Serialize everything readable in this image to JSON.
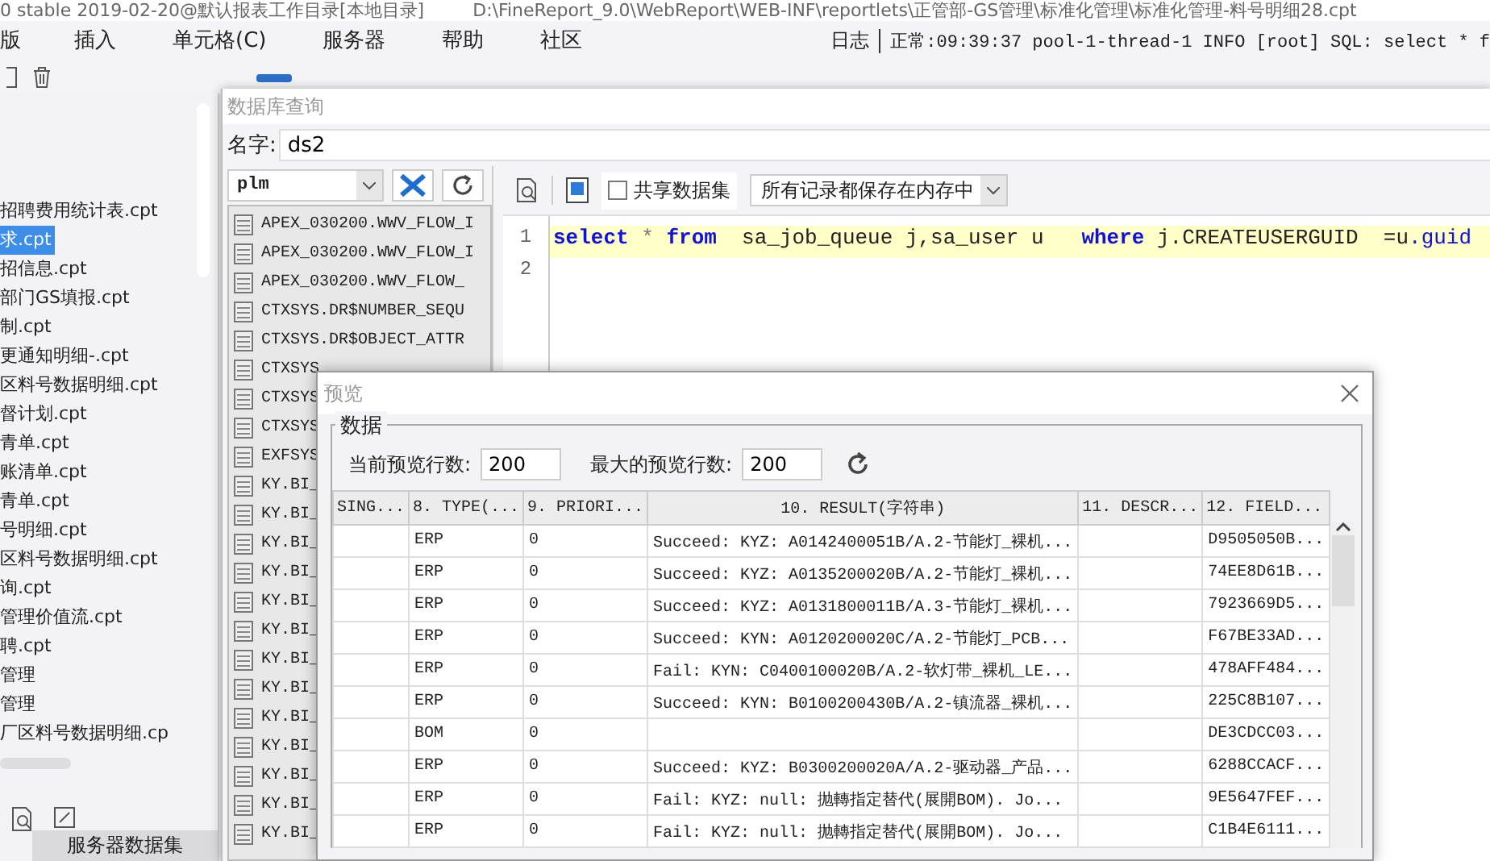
{
  "title_bar": {
    "workspace": "0 stable 2019-02-20@默认报表工作目录[本地目录]",
    "path": "D:\\FineReport_9.0\\WebReport\\WEB-INF\\reportlets\\正管部-GS管理\\标准化管理\\标准化管理-料号明细28.cpt"
  },
  "menu": [
    "版",
    "插入",
    "单元格(C)",
    "服务器",
    "帮助",
    "社区"
  ],
  "log": {
    "label": "日志",
    "message": "正常:09:39:37 pool-1-thread-1 INFO [root] SQL: select * f"
  },
  "file_tree": {
    "items": [
      {
        "label": "招聘费用统计表.cpt",
        "selected": false
      },
      {
        "label": "求.cpt",
        "selected": true
      },
      {
        "label": "招信息.cpt",
        "selected": false
      },
      {
        "label": "部门GS填报.cpt",
        "selected": false
      },
      {
        "label": "制.cpt",
        "selected": false
      },
      {
        "label": "更通知明细-.cpt",
        "selected": false
      },
      {
        "label": "区料号数据明细.cpt",
        "selected": false
      },
      {
        "label": "督计划.cpt",
        "selected": false
      },
      {
        "label": "青单.cpt",
        "selected": false
      },
      {
        "label": "账清单.cpt",
        "selected": false
      },
      {
        "label": "青单.cpt",
        "selected": false
      },
      {
        "label": "号明细.cpt",
        "selected": false
      },
      {
        "label": "区料号数据明细.cpt",
        "selected": false
      },
      {
        "label": "询.cpt",
        "selected": false
      },
      {
        "label": "管理价值流.cpt",
        "selected": false
      },
      {
        "label": "聘.cpt",
        "selected": false
      },
      {
        "label": "管理",
        "selected": false
      },
      {
        "label": "管理",
        "selected": false
      },
      {
        "label": "厂区料号数据明细.cp",
        "selected": false
      }
    ]
  },
  "dataset_tab": {
    "label": "服务器数据集"
  },
  "db_query": {
    "title": "数据库查询",
    "name_label": "名字:",
    "name_value": "ds2",
    "connection": "plm",
    "tables": [
      "APEX_030200.WWV_FLOW_I",
      "APEX_030200.WWV_FLOW_I",
      "APEX_030200.WWV_FLOW_",
      "CTXSYS.DR$NUMBER_SEQU",
      "CTXSYS.DR$OBJECT_ATTR",
      "CTXSYS",
      "CTXSYS",
      "CTXSYS",
      "EXFSYS",
      "KY.BI_",
      "KY.BI_",
      "KY.BI_",
      "KY.BI_",
      "KY.BI_",
      "KY.BI_",
      "KY.BI_",
      "KY.BI_",
      "KY.BI_",
      "KY.BI_",
      "KY.BI_",
      "KY.BI_",
      "KY.BI_"
    ],
    "share_label": "共享数据集",
    "share_checked": false,
    "storage_mode": "所有记录都保存在内存中",
    "sql_lines": [
      {
        "number": "1",
        "highlighted": true,
        "tokens": [
          {
            "text": "select",
            "kind": "keyword"
          },
          {
            "text": " * ",
            "kind": "operator"
          },
          {
            "text": "from",
            "kind": "keyword"
          },
          {
            "text": "  sa_job_queue j,sa_user u   ",
            "kind": "plain"
          },
          {
            "text": "where",
            "kind": "keyword"
          },
          {
            "text": " j.CREATEUSERGUID  =u",
            "kind": "plain"
          },
          {
            "text": ".guid",
            "kind": "field"
          }
        ]
      },
      {
        "number": "2",
        "highlighted": false
      }
    ]
  },
  "preview": {
    "title": "预览",
    "group_label": "数据",
    "current_rows_label": "当前预览行数:",
    "current_rows": "200",
    "max_rows_label": "最大的预览行数:",
    "max_rows": "200",
    "columns": [
      "SING...",
      "8. TYPE(...",
      "9. PRIORI...",
      "10. RESULT(字符串)",
      "11. DESCR...",
      "12. FIELD..."
    ],
    "rows": [
      {
        "type": "ERP",
        "priority": "0",
        "result": "Succeed: KYZ: A0142400051B/A.2-节能灯_裸机...",
        "field": "D9505050B..."
      },
      {
        "type": "ERP",
        "priority": "0",
        "result": "Succeed: KYZ: A0135200020B/A.2-节能灯_裸机...",
        "field": "74EE8D61B..."
      },
      {
        "type": "ERP",
        "priority": "0",
        "result": "Succeed: KYZ: A0131800011B/A.3-节能灯_裸机...",
        "field": "7923669D5..."
      },
      {
        "type": "ERP",
        "priority": "0",
        "result": "Succeed: KYN: A0120200020C/A.2-节能灯_PCB...",
        "field": "F67BE33AD..."
      },
      {
        "type": "ERP",
        "priority": "0",
        "result": "Fail: KYN: C0400100020B/A.2-软灯带_裸机_LE...",
        "field": "478AFF484..."
      },
      {
        "type": "ERP",
        "priority": "0",
        "result": "Succeed: KYN: B0100200430B/A.2-镇流器_裸机...",
        "field": "225C8B107..."
      },
      {
        "type": "BOM",
        "priority": "0",
        "field": "DE3CDCC03..."
      },
      {
        "type": "ERP",
        "priority": "0",
        "result": "Succeed: KYZ: B0300200020A/A.2-驱动器_产品...",
        "field": "6288CCACF..."
      },
      {
        "type": "ERP",
        "priority": "0",
        "result": "Fail: KYZ: null: 抛轉指定替代(展開BOM). Jo...",
        "field": "9E5647FEF..."
      },
      {
        "type": "ERP",
        "priority": "0",
        "result": "Fail: KYZ: null: 抛轉指定替代(展開BOM). Jo...",
        "field": "C1B4E6111..."
      }
    ]
  }
}
